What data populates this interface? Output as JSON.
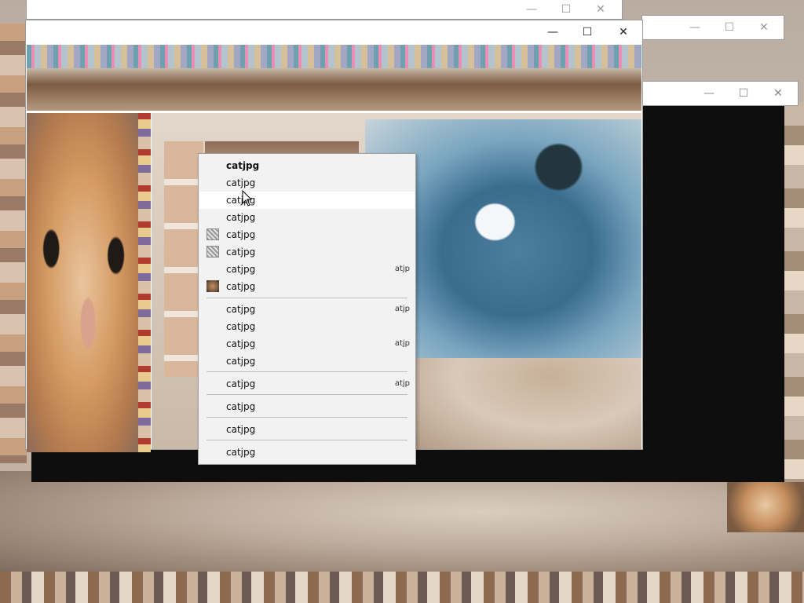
{
  "window_controls": {
    "minimize": "—",
    "maximize": "☐",
    "close": "✕"
  },
  "context_menu": {
    "items": [
      {
        "label": "catjpg",
        "bold": true,
        "icon": "",
        "accel": ""
      },
      {
        "label": "catjpg",
        "icon": "",
        "accel": ""
      },
      {
        "label": "catjpg",
        "icon": "",
        "accel": "",
        "hovered": true
      },
      {
        "label": "catjpg",
        "icon": "",
        "accel": ""
      },
      {
        "label": "catjpg",
        "icon": "image-file-icon",
        "accel": ""
      },
      {
        "label": "catjpg",
        "icon": "image-file-icon",
        "accel": ""
      },
      {
        "label": "catjpg",
        "icon": "",
        "accel": "atjp"
      },
      {
        "label": "catjpg",
        "icon": "cat-photo-icon",
        "accel": ""
      },
      {
        "label": "catjpg",
        "icon": "",
        "accel": "atjp"
      },
      {
        "label": "catjpg",
        "icon": "",
        "accel": ""
      },
      {
        "label": "catjpg",
        "icon": "",
        "accel": "atjp"
      },
      {
        "label": "catjpg",
        "icon": "",
        "accel": ""
      },
      {
        "label": "catjpg",
        "icon": "",
        "accel": "atjp"
      },
      {
        "label": "catjpg",
        "icon": "",
        "accel": ""
      },
      {
        "label": "catjpg",
        "icon": "",
        "accel": ""
      },
      {
        "label": "catjpg",
        "icon": "",
        "accel": ""
      }
    ]
  }
}
